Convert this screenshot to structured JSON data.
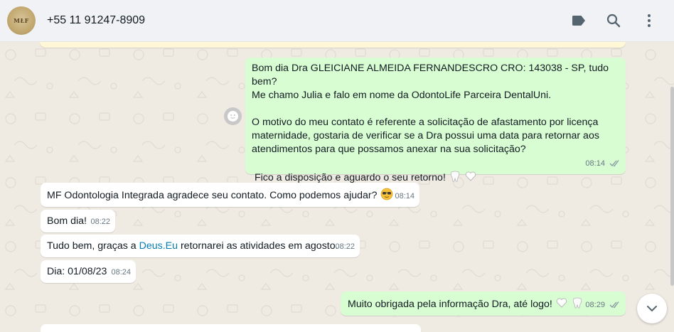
{
  "header": {
    "avatar_text": "MŁF",
    "contact_name": "+55 11 91247-8909",
    "icons": [
      "label-icon",
      "search-icon",
      "menu-icon"
    ]
  },
  "messages": [
    {
      "direction": "out",
      "lines": [
        "Bom dia Dra GLEICIANE ALMEIDA FERNANDESCRO CRO: 143038 - SP, tudo bem?",
        "Me chamo Julia e falo em nome da OdontoLife Parceira DentalUni.",
        "",
        "O motivo do meu contato é referente a solicitação de afastamento por licença",
        "maternidade, gostaria de verificar se a Dra possui uma data para retornar aos",
        "atendimentos para que possamos anexar na sua solicitação?",
        "",
        " Fico a disposição e aguardo o seu retorno!"
      ],
      "time": "08:14"
    },
    {
      "direction": "in",
      "text": "MF Odontologia Integrada agradece seu contato. Como podemos ajudar?",
      "time": "08:14"
    },
    {
      "direction": "in",
      "text": "Bom dia!",
      "time": "08:22"
    },
    {
      "direction": "in",
      "text_before": "Tudo bem, graças a ",
      "link": "Deus.Eu",
      "text_after": " retornarei as atividades em agosto.",
      "time": "08:22"
    },
    {
      "direction": "in",
      "text": "Dia: 01/08/23",
      "time": "08:24"
    },
    {
      "direction": "out",
      "text": "Muito obrigada pela informação Dra, até logo!",
      "time": "08:29"
    }
  ],
  "colors": {
    "chat_bg": "#efeae2",
    "outgoing": "#d9fdd3",
    "incoming": "#ffffff",
    "header_bg": "#f0f2f5",
    "link": "#027eb5"
  }
}
